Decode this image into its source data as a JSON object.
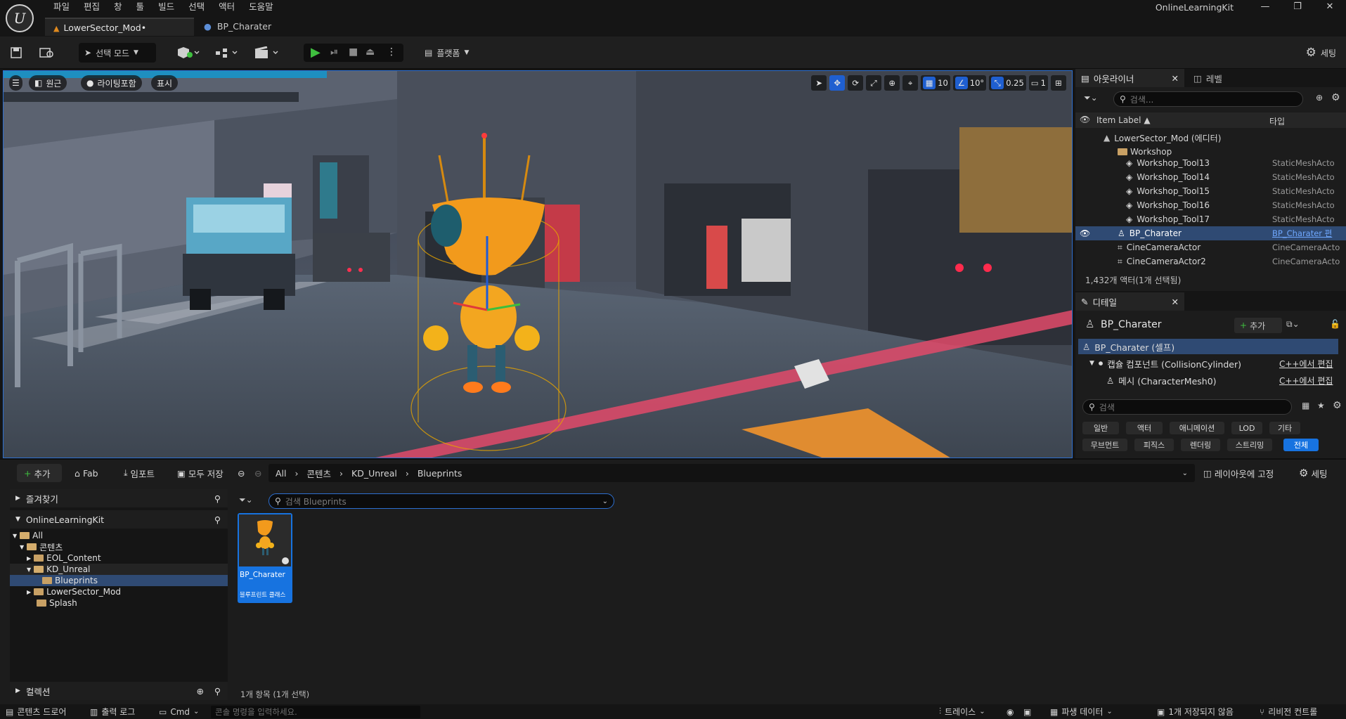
{
  "app": {
    "title": "OnlineLearningKit",
    "logo_text": "U",
    "menu": [
      "파일",
      "편집",
      "창",
      "툴",
      "빌드",
      "선택",
      "액터",
      "도움말"
    ],
    "window_controls": [
      "—",
      "❐",
      "✕"
    ],
    "tabs": [
      {
        "label": "LowerSector_Mod•",
        "icon": "level-icon"
      },
      {
        "label": "BP_Charater",
        "icon": "person-icon"
      }
    ]
  },
  "toolbar": {
    "mode_label": "선택 모드",
    "platform_label": "플랫폼",
    "settings_label": "세팅"
  },
  "viewport": {
    "left_chips": [
      "원근",
      "라이팅포함",
      "표시"
    ],
    "grid_value": "10",
    "rot_value": "10°",
    "scale_value": "0.25",
    "camera_speed": "1"
  },
  "outliner": {
    "tab_label": "아웃라이너",
    "level_tab_label": "레벨",
    "search_placeholder": "검색...",
    "col_label": "Item Label ▲",
    "col_type": "타입",
    "rows": [
      {
        "label": "LowerSector_Mod (에디터)",
        "type": "",
        "indent": 1
      },
      {
        "label": "Workshop",
        "type": "",
        "indent": 2
      },
      {
        "label": "Workshop_Tool13",
        "type": "StaticMeshActo",
        "indent": 3
      },
      {
        "label": "Workshop_Tool14",
        "type": "StaticMeshActo",
        "indent": 3
      },
      {
        "label": "Workshop_Tool15",
        "type": "StaticMeshActo",
        "indent": 3
      },
      {
        "label": "Workshop_Tool16",
        "type": "StaticMeshActo",
        "indent": 3
      },
      {
        "label": "Workshop_Tool17",
        "type": "StaticMeshActo",
        "indent": 3
      },
      {
        "label": "BP_Charater",
        "type": "BP_Charater 편",
        "indent": 2,
        "selected": true
      },
      {
        "label": "CineCameraActor",
        "type": "CineCameraActo",
        "indent": 2
      },
      {
        "label": "CineCameraActor2",
        "type": "CineCameraActo",
        "indent": 2
      }
    ],
    "actor_count": "1,432개 액터(1개 선택됨)"
  },
  "details": {
    "tab_label": "디테일",
    "actor_name": "BP_Charater",
    "add_label": "추가",
    "components": [
      {
        "label": "BP_Charater (셀프)",
        "cpp": "",
        "selected": true
      },
      {
        "label": "캡슐 컴포넌트 (CollisionCylinder)",
        "cpp": "C++에서 편집"
      },
      {
        "label": "메시 (CharacterMesh0)",
        "cpp": "C++에서 편집"
      }
    ],
    "search_placeholder": "검색",
    "categories_row1": [
      "일반",
      "액터",
      "애니메이션",
      "LOD",
      "기타"
    ],
    "categories_row2": [
      "무브먼트",
      "피직스",
      "렌더링",
      "스트리밍",
      "전체"
    ]
  },
  "content_browser": {
    "add_label": "추가",
    "fab_label": "Fab",
    "import_label": "임포트",
    "save_all_label": "모두 저장",
    "path": [
      "All",
      "콘텐츠",
      "KD_Unreal",
      "Blueprints"
    ],
    "lock_label": "레이아웃에 고정",
    "settings_label": "세팅",
    "favorites_label": "즐겨찾기",
    "project_label": "OnlineLearningKit",
    "collections_label": "컬렉션",
    "folders": [
      {
        "label": "All",
        "indent": 0
      },
      {
        "label": "콘텐츠",
        "indent": 1
      },
      {
        "label": "EOL_Content",
        "indent": 2
      },
      {
        "label": "KD_Unreal",
        "indent": 2
      },
      {
        "label": "Blueprints",
        "indent": 3,
        "selected": true
      },
      {
        "label": "LowerSector_Mod",
        "indent": 2
      },
      {
        "label": "Splash",
        "indent": 2
      }
    ],
    "asset_search_placeholder": "검색 Blueprints",
    "asset": {
      "name": "BP_Charater",
      "type": "블루프린트 클래스"
    },
    "item_count": "1개 항목 (1개 선택)"
  },
  "statusbar": {
    "content_drawer": "콘텐츠 드로어",
    "output_log": "출력 로그",
    "cmd_label": "Cmd",
    "cmd_placeholder": "콘솔 명령을 입력하세요.",
    "trace": "트레이스",
    "derived_data": "파생 데이터",
    "unsaved": "1개 저장되지 않음",
    "revision": "리비전 컨트롤"
  }
}
